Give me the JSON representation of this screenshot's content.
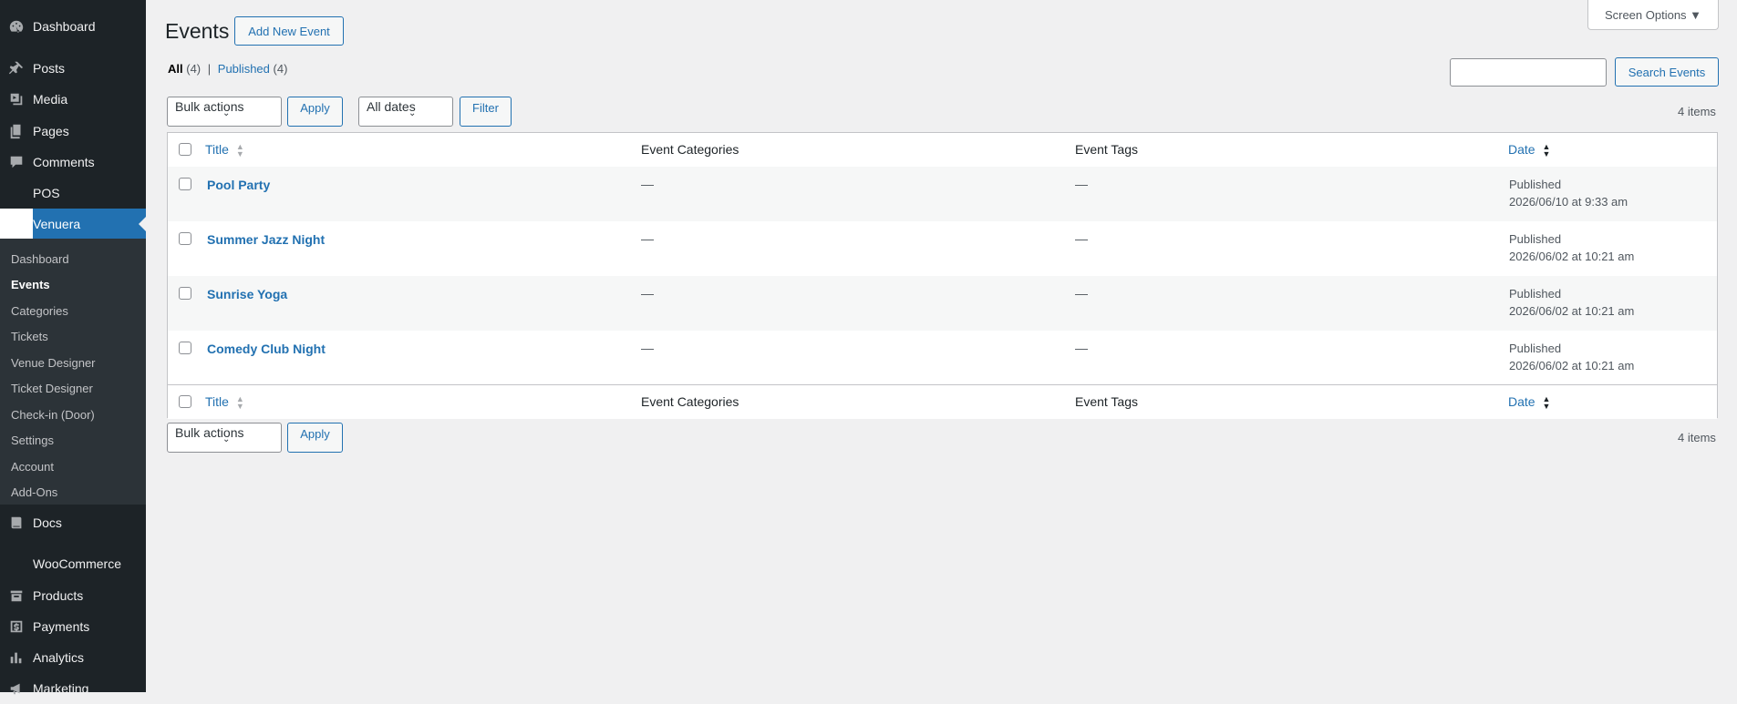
{
  "sidebar": {
    "top_items": [
      {
        "label": "Dashboard",
        "icon": "dashboard-icon"
      },
      {
        "label": "Posts",
        "icon": "pin-icon"
      },
      {
        "label": "Media",
        "icon": "media-icon"
      },
      {
        "label": "Pages",
        "icon": "pages-icon"
      },
      {
        "label": "Comments",
        "icon": "comments-icon"
      },
      {
        "label": "POS",
        "icon": "pos-icon"
      },
      {
        "label": "Venuera",
        "icon": "venuera-icon"
      }
    ],
    "submenu": [
      "Dashboard",
      "Events",
      "Categories",
      "Tickets",
      "Venue Designer",
      "Ticket Designer",
      "Check-in (Door)",
      "Settings",
      "Account",
      "Add-Ons"
    ],
    "bottom_items": [
      {
        "label": "Docs",
        "icon": "docs-icon"
      },
      {
        "label": "WooCommerce",
        "icon": "woocommerce-icon"
      },
      {
        "label": "Products",
        "icon": "products-icon"
      },
      {
        "label": "Payments",
        "icon": "payments-icon"
      },
      {
        "label": "Analytics",
        "icon": "analytics-icon"
      },
      {
        "label": "Marketing",
        "icon": "marketing-icon"
      }
    ]
  },
  "header": {
    "title": "Events",
    "add_new": "Add New Event",
    "screen_options": "Screen Options ▼"
  },
  "views": {
    "all_label": "All",
    "all_count": "(4)",
    "separator": "|",
    "published_label": "Published",
    "published_count": "(4)"
  },
  "search": {
    "button": "Search Events",
    "value": ""
  },
  "toolbar_top": {
    "bulk": "Bulk actions",
    "apply": "Apply",
    "dates": "All dates",
    "filter": "Filter",
    "count": "4 items"
  },
  "toolbar_bottom": {
    "bulk": "Bulk actions",
    "apply": "Apply",
    "count": "4 items"
  },
  "table": {
    "columns": [
      "Title",
      "Event Categories",
      "Event Tags",
      "Date"
    ],
    "rows": [
      {
        "title": "Pool Party",
        "categories": "—",
        "tags": "—",
        "status": "Published",
        "date": "2026/06/10 at 9:33 am"
      },
      {
        "title": "Summer Jazz Night",
        "categories": "—",
        "tags": "—",
        "status": "Published",
        "date": "2026/06/02 at 10:21 am"
      },
      {
        "title": "Sunrise Yoga",
        "categories": "—",
        "tags": "—",
        "status": "Published",
        "date": "2026/06/02 at 10:21 am"
      },
      {
        "title": "Comedy Club Night",
        "categories": "—",
        "tags": "—",
        "status": "Published",
        "date": "2026/06/02 at 10:21 am"
      }
    ]
  },
  "colors": {
    "accent": "#2271b1",
    "sidebar_bg": "#1d2327",
    "submenu_bg": "#2c3338"
  }
}
